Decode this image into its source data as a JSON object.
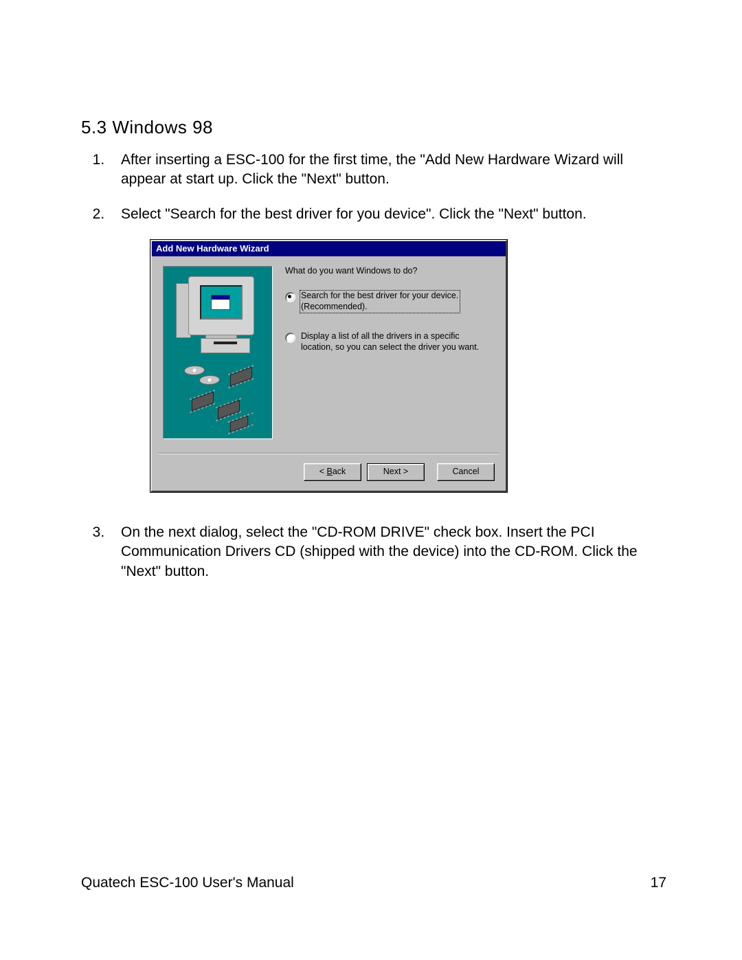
{
  "heading": "5.3  Windows 98",
  "steps": {
    "s1": "After inserting a ESC-100 for the first time, the \"Add New Hardware Wizard will appear at start up. Click the \"Next\" button.",
    "s2": "Select \"Search for the best driver for you device\". Click the \"Next\" button.",
    "s3": "On the next dialog, select the \"CD-ROM DRIVE\" check box. Insert the PCI Communication Drivers CD (shipped with the device) into the CD-ROM. Click the \"Next\" button."
  },
  "dialog": {
    "title": "Add New Hardware Wizard",
    "prompt": "What do you want Windows to do?",
    "option1_line1": "Search for the best driver for your device.",
    "option1_line2": "(Recommended).",
    "option2_line1": "Display a list of all the drivers in a specific",
    "option2_line2": "location, so you can select the driver you want.",
    "back_pre": "< ",
    "back_key": "B",
    "back_post": "ack",
    "next": "Next >",
    "cancel": "Cancel"
  },
  "footer": {
    "left": "Quatech  ESC-100 User's Manual",
    "right": "17"
  }
}
